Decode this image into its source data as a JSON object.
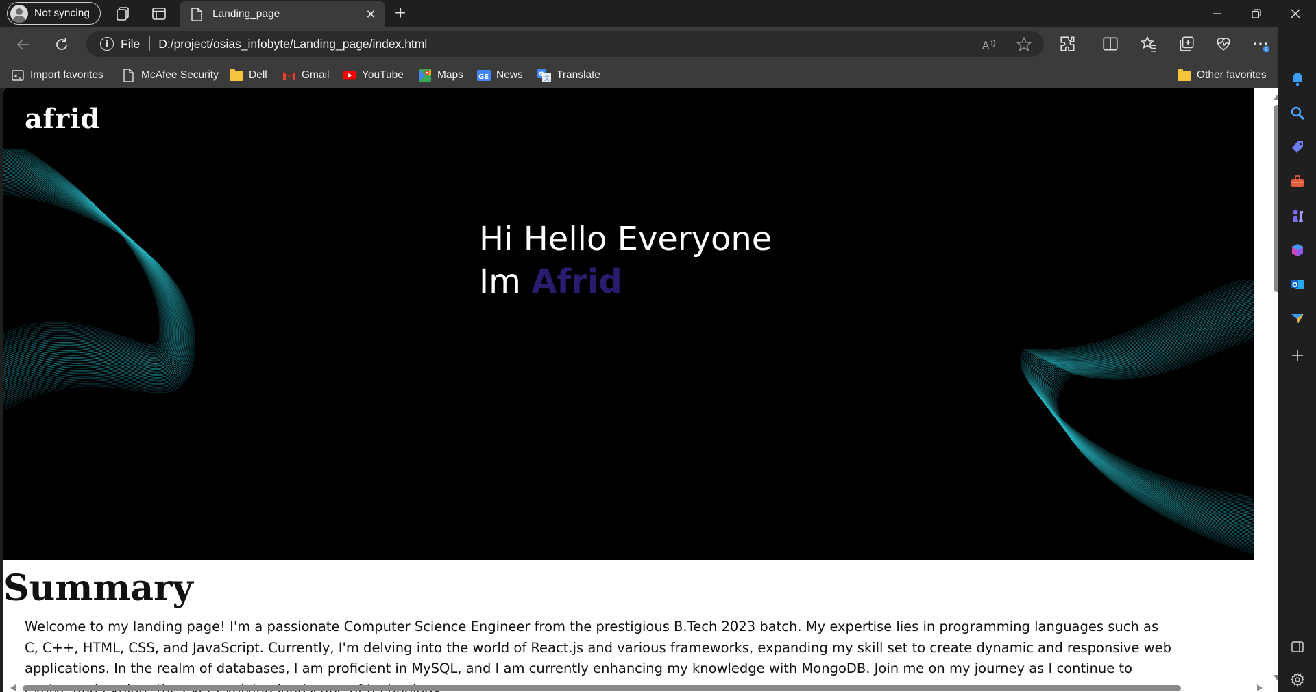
{
  "browser": {
    "profile_label": "Not syncing",
    "tab_title": "Landing_page",
    "address": {
      "scheme_label": "File",
      "url": "D:/project/osias_infobyte/Landing_page/index.html"
    },
    "favorites": [
      {
        "label": "Import favorites",
        "icon": "import-icon"
      },
      {
        "label": "McAfee Security",
        "icon": "page-icon"
      },
      {
        "label": "Dell",
        "icon": "folder-icon"
      },
      {
        "label": "Gmail",
        "icon": "gmail-icon"
      },
      {
        "label": "YouTube",
        "icon": "youtube-icon"
      },
      {
        "label": "Maps",
        "icon": "maps-icon"
      },
      {
        "label": "News",
        "icon": "news-icon"
      },
      {
        "label": "Translate",
        "icon": "translate-icon"
      }
    ],
    "other_favorites": "Other favorites"
  },
  "page": {
    "brand": "afrid",
    "hero": {
      "greeting": "Hi Hello Everyone",
      "intro_prefix": "Im",
      "name": "Afrid",
      "name_color": "#281c6e",
      "wave_color": "#2ab8c4"
    },
    "summary": {
      "title": "Summary",
      "body": "Welcome to my landing page! I'm a passionate Computer Science Engineer from the prestigious B.Tech 2023 batch. My expertise lies in programming languages such as C, C++, HTML, CSS, and JavaScript. Currently, I'm delving into the world of React.js and various frameworks, expanding my skill set to create dynamic and responsive web applications. In the realm of databases, I am proficient in MySQL, and I am currently enhancing my knowledge with MongoDB. Join me on my journey as I continue to evolve and explore the ever-evolving landscape of technology."
    }
  }
}
